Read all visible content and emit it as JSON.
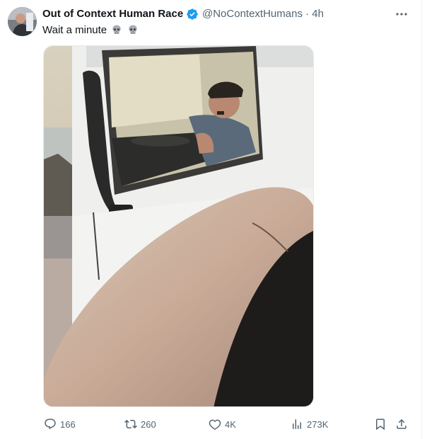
{
  "tweet": {
    "author_name": "Out of Context Human Race",
    "handle": "@NoContextHumans",
    "time": "· 4h",
    "text": "Wait a minute",
    "emoji": [
      "skull",
      "skull"
    ]
  },
  "metrics": {
    "replies": "166",
    "retweets": "260",
    "likes": "4K",
    "views": "273K"
  },
  "icons": {
    "verified": "verified-badge-icon",
    "more": "more-options-icon",
    "reply": "reply-icon",
    "retweet": "retweet-icon",
    "like": "heart-icon",
    "views": "views-icon",
    "bookmark": "bookmark-icon",
    "share": "share-icon"
  },
  "colors": {
    "accent": "#1d9bf0",
    "text": "#0f1419",
    "muted": "#536471"
  }
}
